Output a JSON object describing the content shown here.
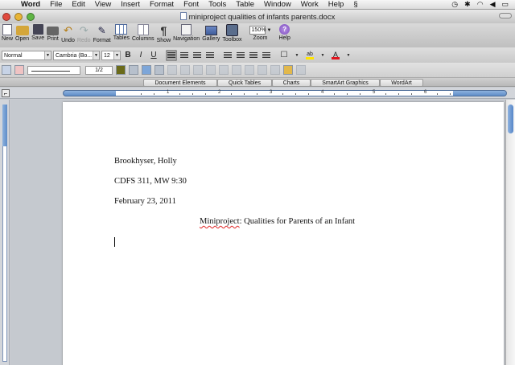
{
  "menubar": {
    "items": [
      "Word",
      "File",
      "Edit",
      "View",
      "Insert",
      "Format",
      "Font",
      "Tools",
      "Table",
      "Window",
      "Work",
      "Help"
    ]
  },
  "window": {
    "title": "miniproject qualities of infants parents.docx"
  },
  "toolbar": {
    "buttons": [
      {
        "label": "New",
        "icon": "new-document-icon"
      },
      {
        "label": "Open",
        "icon": "open-folder-icon"
      },
      {
        "label": "Save",
        "icon": "save-icon"
      },
      {
        "label": "Print",
        "icon": "print-icon"
      },
      {
        "label": "Undo",
        "icon": "undo-icon"
      },
      {
        "label": "Redo",
        "icon": "redo-icon"
      },
      {
        "label": "Format",
        "icon": "format-painter-icon"
      },
      {
        "label": "Tables",
        "icon": "table-icon"
      },
      {
        "label": "Columns",
        "icon": "columns-icon"
      },
      {
        "label": "Show",
        "icon": "pilcrow-icon"
      },
      {
        "label": "Navigation",
        "icon": "navigation-pane-icon"
      },
      {
        "label": "Gallery",
        "icon": "gallery-icon"
      },
      {
        "label": "Toolbox",
        "icon": "toolbox-icon"
      }
    ],
    "zoom_value": "150%",
    "zoom_label": "Zoom",
    "help_label": "Help"
  },
  "format": {
    "style": "Normal",
    "font": "Cambria (Bo...",
    "size": "12",
    "bold": "B",
    "italic": "I",
    "underline": "U",
    "highlight_glyph": "ab",
    "font_color_glyph": "A"
  },
  "table_bar": {
    "line_weight": "1/2"
  },
  "ribbon": {
    "tabs": [
      "Document Elements",
      "Quick Tables",
      "Charts",
      "SmartArt Graphics",
      "WordArt"
    ]
  },
  "ruler": {
    "numbers": [
      "1",
      "2",
      "3",
      "4",
      "5",
      "6"
    ]
  },
  "document": {
    "lines": [
      "Brookhyser, Holly",
      "CDFS 311, MW 9:30",
      "February 23, 2011"
    ],
    "title_misspelled": "Miniproject",
    "title_rest": ": Qualities for Parents of an Infant"
  }
}
